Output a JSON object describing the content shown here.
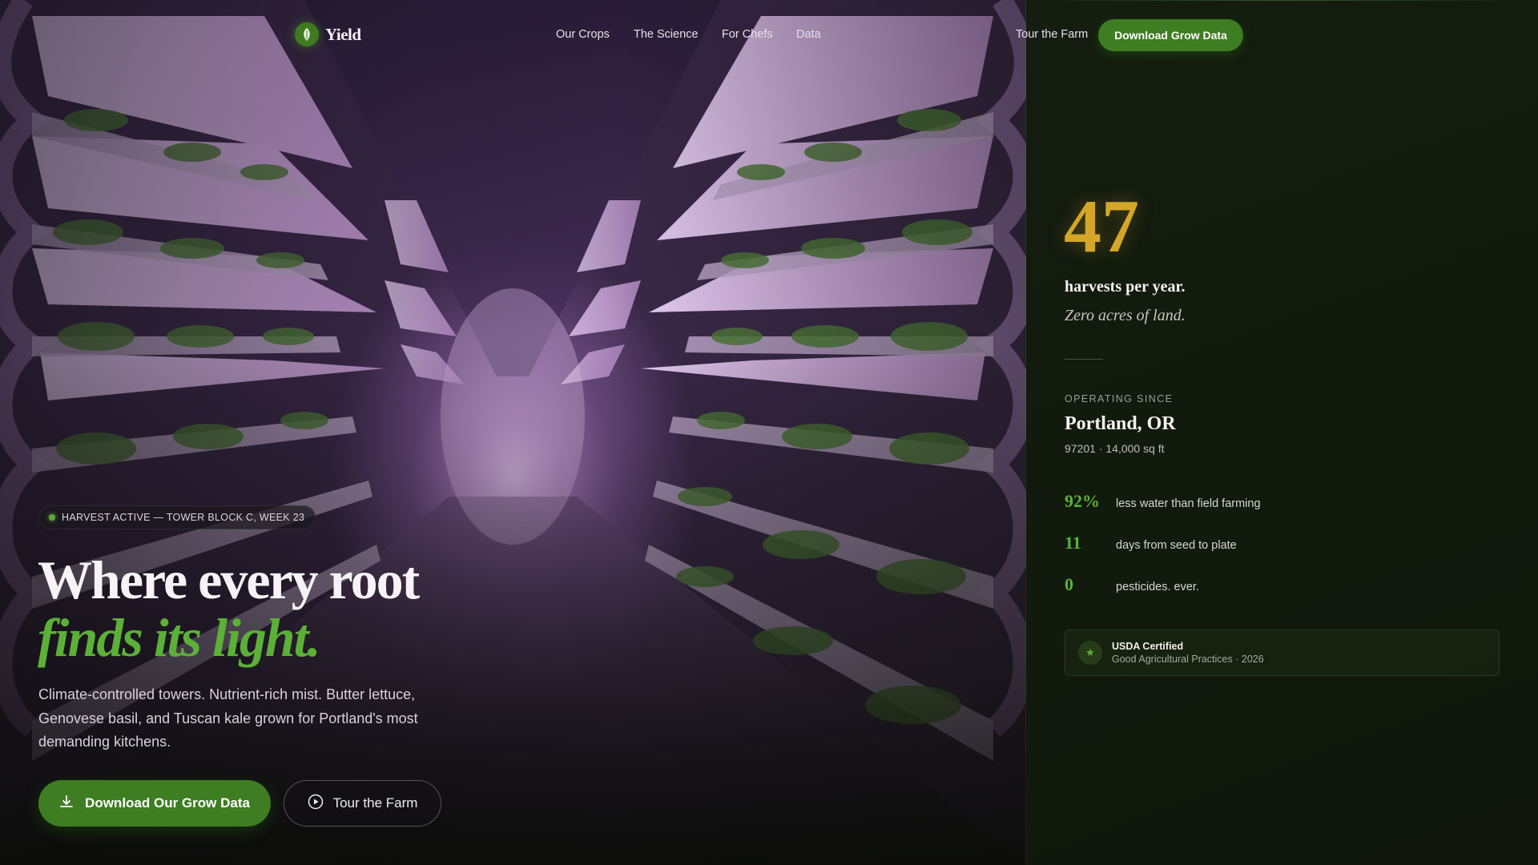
{
  "brand": {
    "name": "Yield",
    "logo_icon": "leaf-icon",
    "accent": "#3e7d22",
    "gold": "#d4a62a"
  },
  "nav": {
    "links": [
      "Our Crops",
      "The Science",
      "For Chefs",
      "Data"
    ],
    "tour_label": "Tour the Farm",
    "cta_label": "Download Grow Data"
  },
  "hero": {
    "badge": "HARVEST ACTIVE — TOWER BLOCK C, WEEK 23",
    "headline_line1": "Where every root",
    "headline_line2": "finds its light.",
    "lede": "Climate-controlled towers. Nutrient-rich mist. Butter lettuce, Genovese basil, and Tuscan kale grown for Portland's most demanding kitchens.",
    "primary_label": "Download Our Grow Data",
    "primary_icon": "download-icon",
    "secondary_label": "Tour the Farm",
    "secondary_icon": "play-icon"
  },
  "panel": {
    "big_number": "47",
    "big_label": "harvests per year.",
    "big_sub": "Zero acres of land.",
    "operating_label": "OPERATING SINCE",
    "city": "Portland, OR",
    "meta": "97201 · 14,000 sq ft",
    "stats": [
      {
        "value": "92%",
        "text": "less water than field farming"
      },
      {
        "value": "11",
        "text": "days from seed to plate"
      },
      {
        "value": "0",
        "text": "pesticides. ever."
      }
    ],
    "cert": {
      "icon": "star-icon",
      "title": "USDA Certified",
      "subtitle": "Good Agricultural Practices · 2026"
    }
  }
}
